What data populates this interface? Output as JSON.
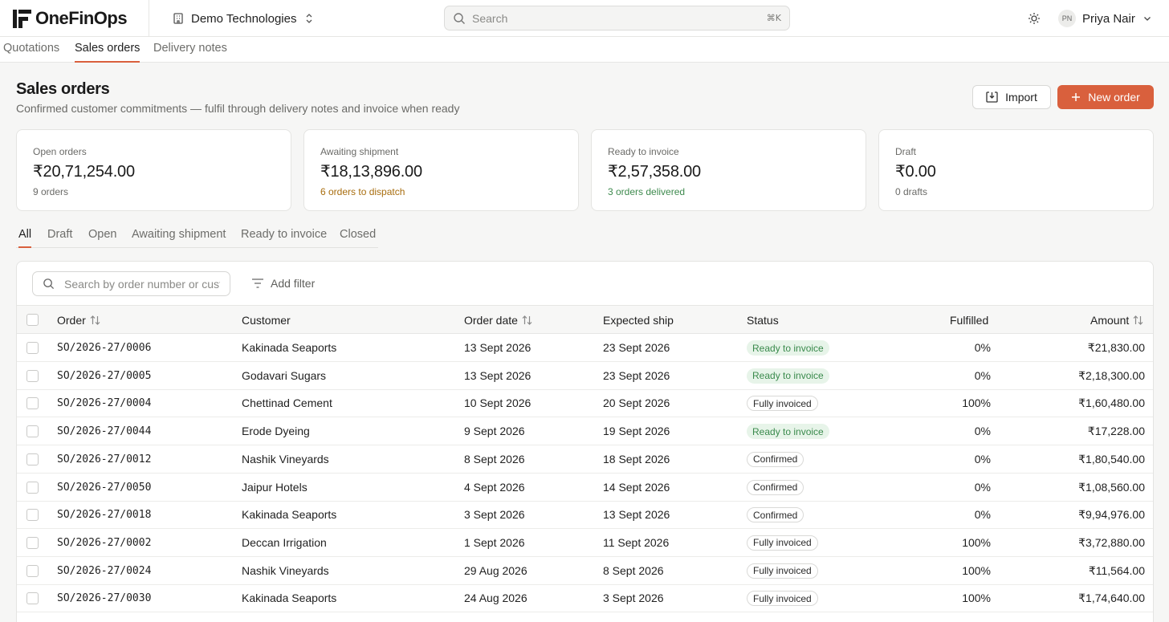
{
  "app": {
    "name": "OneFinOps"
  },
  "org": {
    "name": "Demo Technologies"
  },
  "search": {
    "placeholder": "Search",
    "shortcut": "⌘K"
  },
  "user": {
    "initials": "PN",
    "name": "Priya Nair"
  },
  "tabs": [
    {
      "label": "Quotations"
    },
    {
      "label": "Sales orders",
      "active": true
    },
    {
      "label": "Delivery notes"
    }
  ],
  "page": {
    "title": "Sales orders",
    "subtitle": "Confirmed customer commitments — fulfil through delivery notes and invoice when ready",
    "import_label": "Import",
    "new_label": "New order",
    "accent": "#d9603d"
  },
  "kpis": [
    {
      "label": "Open orders",
      "value": "₹20,71,254.00",
      "note": "9 orders",
      "tone": ""
    },
    {
      "label": "Awaiting shipment",
      "value": "₹18,13,896.00",
      "note": "6 orders to dispatch",
      "tone": "amber"
    },
    {
      "label": "Ready to invoice",
      "value": "₹2,57,358.00",
      "note": "3 orders delivered",
      "tone": "green"
    },
    {
      "label": "Draft",
      "value": "₹0.00",
      "note": "0 drafts",
      "tone": ""
    }
  ],
  "filters": [
    {
      "label": "All",
      "active": true
    },
    {
      "label": "Draft"
    },
    {
      "label": "Open"
    },
    {
      "label": "Awaiting shipment"
    },
    {
      "label": "Ready to invoice"
    },
    {
      "label": "Closed"
    }
  ],
  "table": {
    "search_placeholder": "Search by order number or customer",
    "add_filter_label": "Add filter",
    "columns": {
      "order": "Order",
      "customer": "Customer",
      "order_date": "Order date",
      "expected_ship": "Expected ship",
      "status": "Status",
      "fulfilled": "Fulfilled",
      "amount": "Amount"
    },
    "rows": [
      {
        "order": "SO/2026-27/0006",
        "customer": "Kakinada Seaports",
        "order_date": "13 Sept 2026",
        "expected_ship": "23 Sept 2026",
        "status": "Ready to invoice",
        "tone": "green",
        "fulfilled": "0%",
        "amount": "₹21,830.00"
      },
      {
        "order": "SO/2026-27/0005",
        "customer": "Godavari Sugars",
        "order_date": "13 Sept 2026",
        "expected_ship": "23 Sept 2026",
        "status": "Ready to invoice",
        "tone": "green",
        "fulfilled": "0%",
        "amount": "₹2,18,300.00"
      },
      {
        "order": "SO/2026-27/0004",
        "customer": "Chettinad Cement",
        "order_date": "10 Sept 2026",
        "expected_ship": "20 Sept 2026",
        "status": "Fully invoiced",
        "tone": "plain",
        "fulfilled": "100%",
        "amount": "₹1,60,480.00"
      },
      {
        "order": "SO/2026-27/0044",
        "customer": "Erode Dyeing",
        "order_date": "9 Sept 2026",
        "expected_ship": "19 Sept 2026",
        "status": "Ready to invoice",
        "tone": "green",
        "fulfilled": "0%",
        "amount": "₹17,228.00"
      },
      {
        "order": "SO/2026-27/0012",
        "customer": "Nashik Vineyards",
        "order_date": "8 Sept 2026",
        "expected_ship": "18 Sept 2026",
        "status": "Confirmed",
        "tone": "plain",
        "fulfilled": "0%",
        "amount": "₹1,80,540.00"
      },
      {
        "order": "SO/2026-27/0050",
        "customer": "Jaipur Hotels",
        "order_date": "4 Sept 2026",
        "expected_ship": "14 Sept 2026",
        "status": "Confirmed",
        "tone": "plain",
        "fulfilled": "0%",
        "amount": "₹1,08,560.00"
      },
      {
        "order": "SO/2026-27/0018",
        "customer": "Kakinada Seaports",
        "order_date": "3 Sept 2026",
        "expected_ship": "13 Sept 2026",
        "status": "Confirmed",
        "tone": "plain",
        "fulfilled": "0%",
        "amount": "₹9,94,976.00"
      },
      {
        "order": "SO/2026-27/0002",
        "customer": "Deccan Irrigation",
        "order_date": "1 Sept 2026",
        "expected_ship": "11 Sept 2026",
        "status": "Fully invoiced",
        "tone": "plain",
        "fulfilled": "100%",
        "amount": "₹3,72,880.00"
      },
      {
        "order": "SO/2026-27/0024",
        "customer": "Nashik Vineyards",
        "order_date": "29 Aug 2026",
        "expected_ship": "8 Sept 2026",
        "status": "Fully invoiced",
        "tone": "plain",
        "fulfilled": "100%",
        "amount": "₹11,564.00"
      },
      {
        "order": "SO/2026-27/0030",
        "customer": "Kakinada Seaports",
        "order_date": "24 Aug 2026",
        "expected_ship": "3 Sept 2026",
        "status": "Fully invoiced",
        "tone": "plain",
        "fulfilled": "100%",
        "amount": "₹1,74,640.00"
      }
    ]
  }
}
